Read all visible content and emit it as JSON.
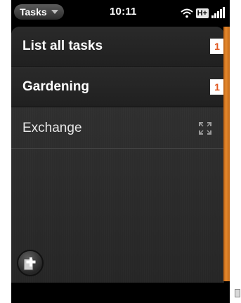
{
  "statusbar": {
    "app_menu_label": "Tasks",
    "time": "10:11",
    "network_label": "H+"
  },
  "task_lists": [
    {
      "label": "List all tasks",
      "badge": "1"
    },
    {
      "label": "Gardening",
      "badge": "1"
    },
    {
      "label": "Exchange"
    }
  ],
  "icons": {
    "menu_caret": "chevron-down-icon",
    "wifi": "wifi-icon",
    "signal": "signal-icon",
    "sync": "sync-icon",
    "add": "add-list-icon"
  },
  "colors": {
    "badge_text": "#e0571f",
    "ribbon": "#e5892d"
  }
}
